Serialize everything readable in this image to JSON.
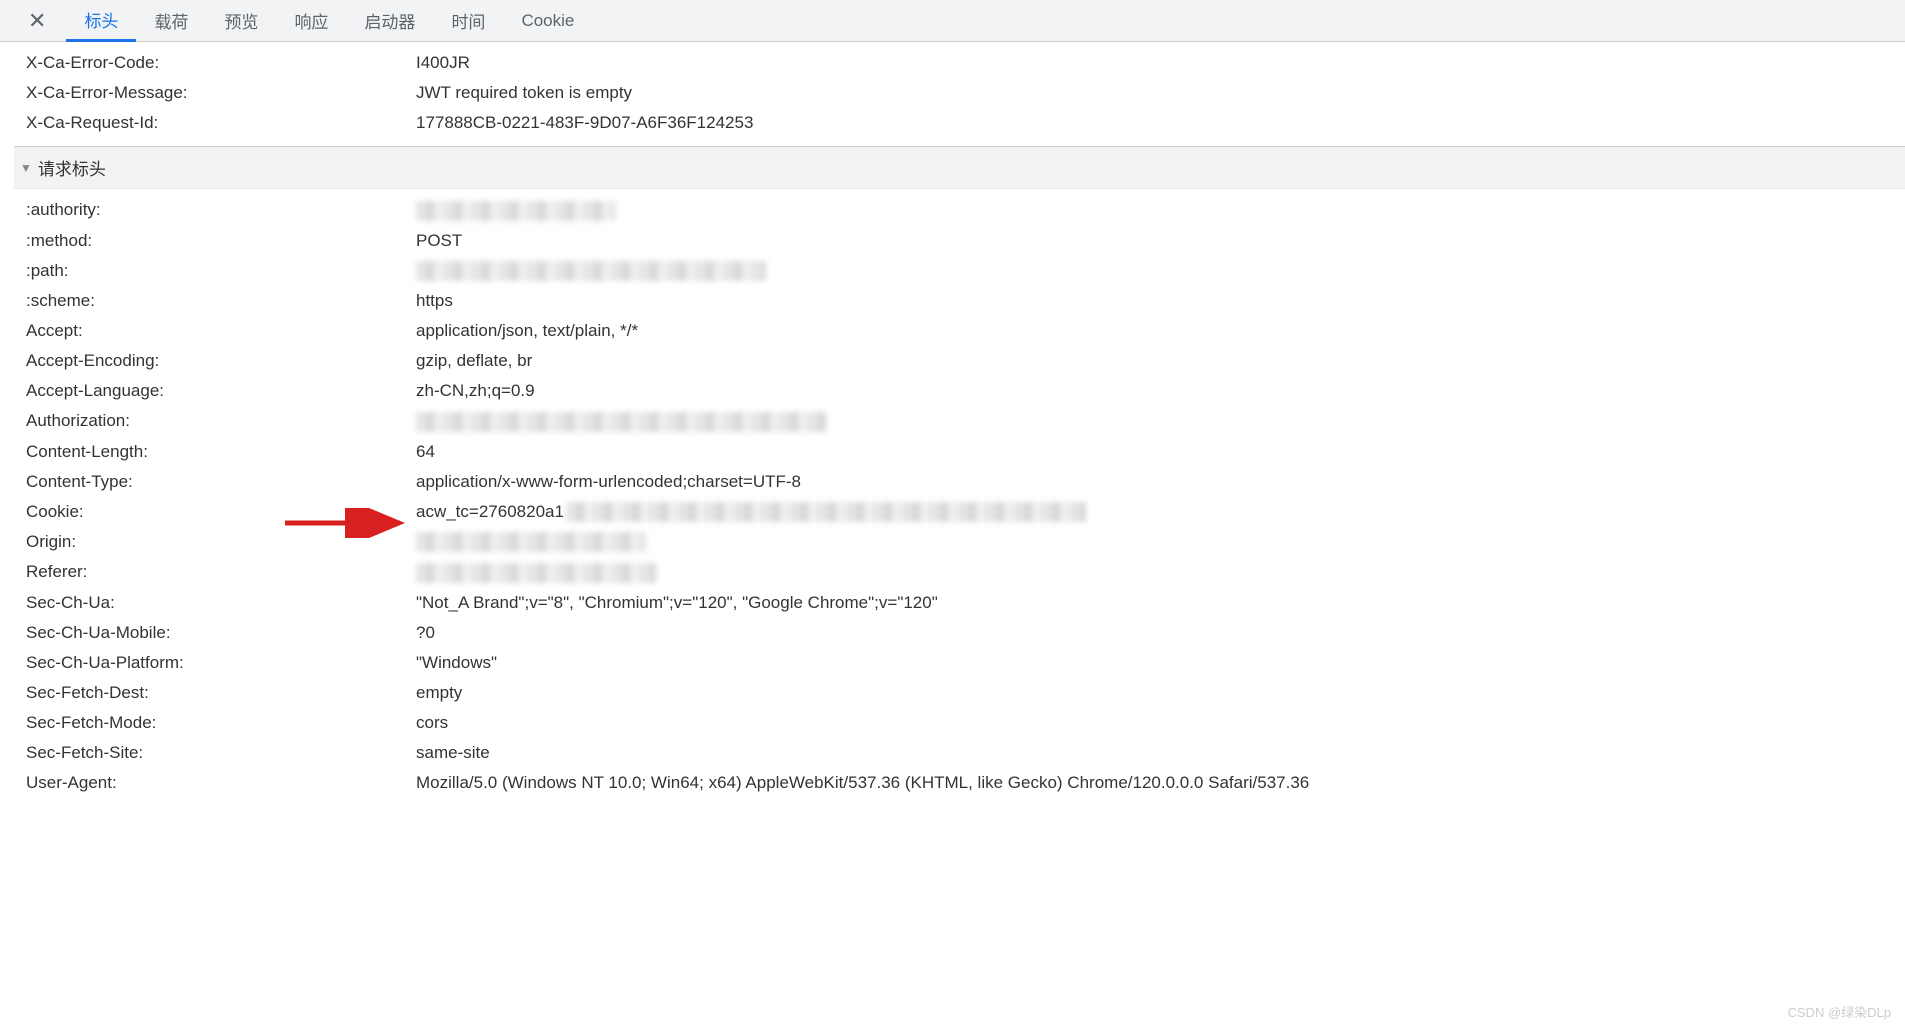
{
  "tabs": {
    "close": "✕",
    "items": [
      "标头",
      "载荷",
      "预览",
      "响应",
      "启动器",
      "时间",
      "Cookie"
    ],
    "active_index": 0
  },
  "response_headers": [
    {
      "key": "X-Ca-Error-Code:",
      "value": "I400JR"
    },
    {
      "key": "X-Ca-Error-Message:",
      "value": "JWT required token is empty"
    },
    {
      "key": "X-Ca-Request-Id:",
      "value": "177888CB-0221-483F-9D07-A6F36F124253"
    }
  ],
  "request_section_title": "请求标头",
  "request_headers": [
    {
      "key": ":authority:",
      "value": "",
      "blur": "blur-a"
    },
    {
      "key": ":method:",
      "value": "POST"
    },
    {
      "key": ":path:",
      "value": "",
      "blur": "blur-b"
    },
    {
      "key": ":scheme:",
      "value": "https"
    },
    {
      "key": "Accept:",
      "value": "application/json, text/plain, */*"
    },
    {
      "key": "Accept-Encoding:",
      "value": "gzip, deflate, br"
    },
    {
      "key": "Accept-Language:",
      "value": "zh-CN,zh;q=0.9"
    },
    {
      "key": "Authorization:",
      "value": "",
      "blur": "blur-c"
    },
    {
      "key": "Content-Length:",
      "value": "64"
    },
    {
      "key": "Content-Type:",
      "value": "application/x-www-form-urlencoded;charset=UTF-8"
    },
    {
      "key": "Cookie:",
      "value": "acw_tc=2760820a1",
      "blur_after": "blur-cookie"
    },
    {
      "key": "Origin:",
      "value": "",
      "blur": "blur-d"
    },
    {
      "key": "Referer:",
      "value": "",
      "blur": "blur-e"
    },
    {
      "key": "Sec-Ch-Ua:",
      "value": "\"Not_A Brand\";v=\"8\", \"Chromium\";v=\"120\", \"Google Chrome\";v=\"120\""
    },
    {
      "key": "Sec-Ch-Ua-Mobile:",
      "value": "?0"
    },
    {
      "key": "Sec-Ch-Ua-Platform:",
      "value": "\"Windows\""
    },
    {
      "key": "Sec-Fetch-Dest:",
      "value": "empty"
    },
    {
      "key": "Sec-Fetch-Mode:",
      "value": "cors"
    },
    {
      "key": "Sec-Fetch-Site:",
      "value": "same-site"
    },
    {
      "key": "User-Agent:",
      "value": "Mozilla/5.0 (Windows NT 10.0; Win64; x64) AppleWebKit/537.36 (KHTML, like Gecko) Chrome/120.0.0.0 Safari/537.36"
    }
  ],
  "watermark": "CSDN @绿染DLp"
}
